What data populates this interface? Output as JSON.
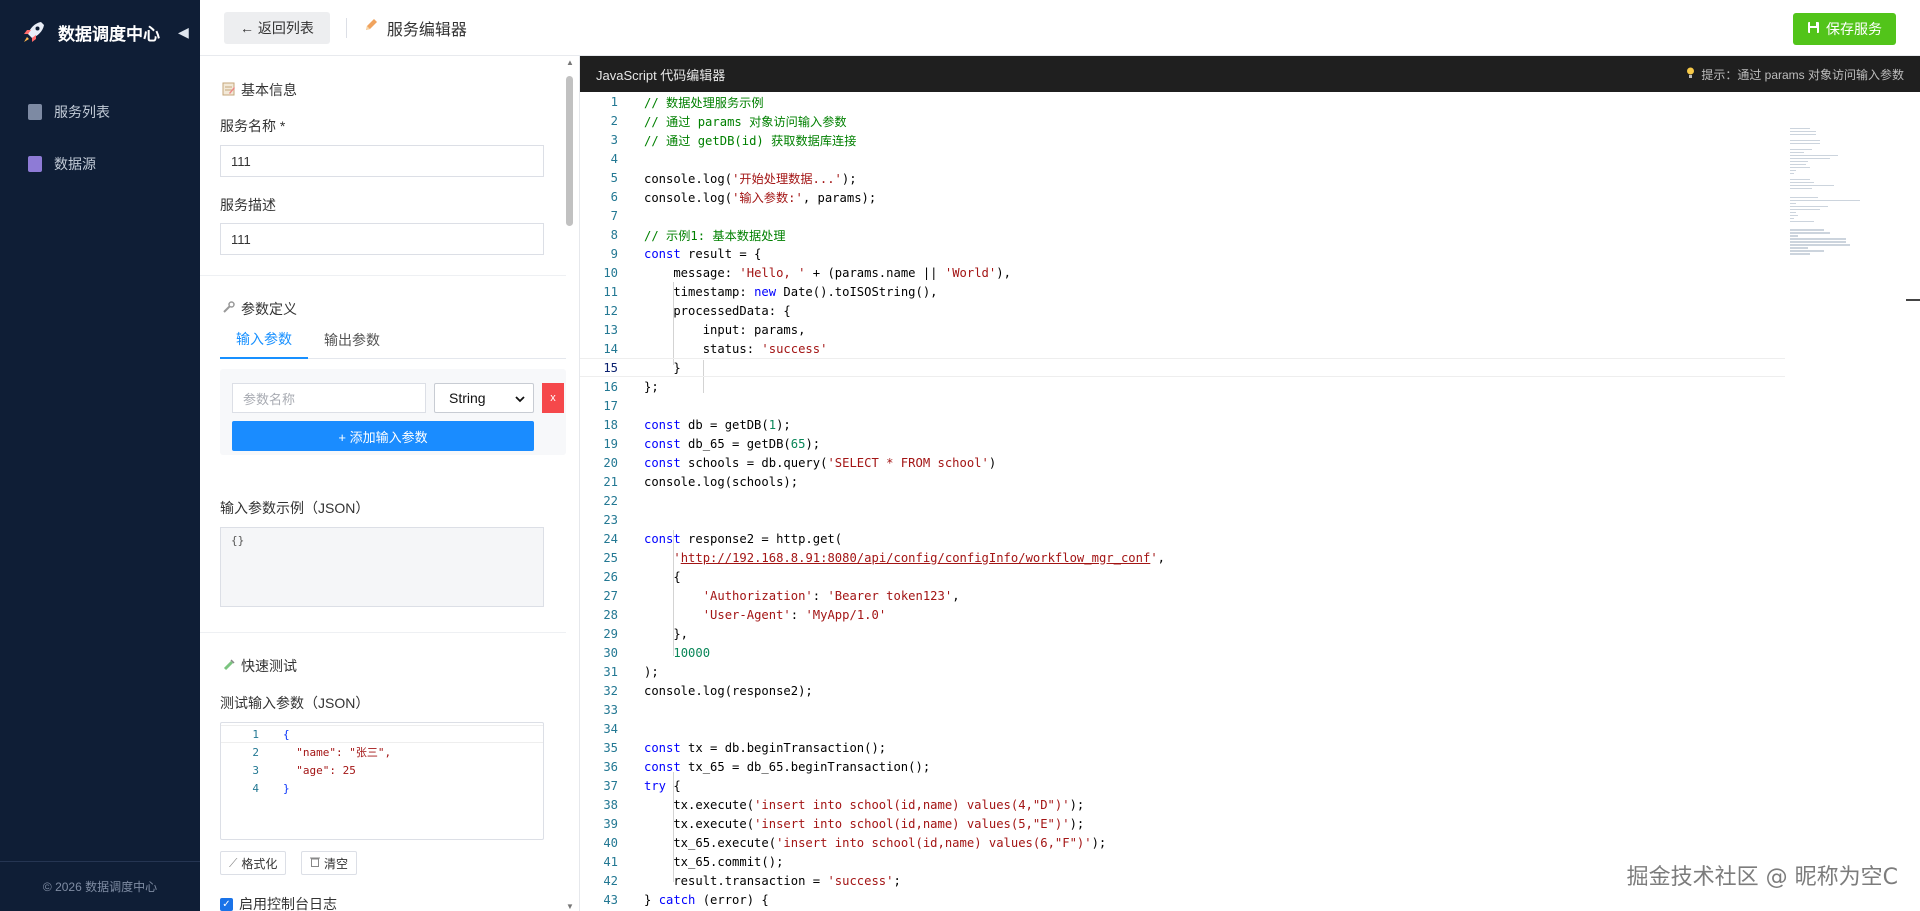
{
  "sidebar": {
    "brand": "数据调度中心",
    "items": [
      {
        "label": "服务列表",
        "icon": "document-icon",
        "color": "#7d8aa3"
      },
      {
        "label": "数据源",
        "icon": "database-icon",
        "color": "#8e7bd6"
      }
    ],
    "footer": "© 2026 数据调度中心"
  },
  "topbar": {
    "back_label": "← 返回列表",
    "title": "服务编辑器",
    "save_label": "保存服务"
  },
  "form": {
    "basic_title": "基本信息",
    "name_label": "服务名称 *",
    "name_value": "111",
    "desc_label": "服务描述",
    "desc_value": "111",
    "params_title": "参数定义",
    "tabs": [
      "输入参数",
      "输出参数"
    ],
    "param_placeholder": "参数名称",
    "param_type": "String",
    "param_delete": "x",
    "add_param": "+ 添加输入参数",
    "input_example_label": "输入参数示例（JSON）",
    "input_example_value": "{}",
    "quick_test_title": "快速测试",
    "test_input_label": "测试输入参数（JSON）",
    "test_lines": [
      {
        "n": "1",
        "code": "{"
      },
      {
        "n": "2",
        "code": "  \"name\": \"张三\","
      },
      {
        "n": "3",
        "code": "  \"age\": 25"
      },
      {
        "n": "4",
        "code": "}"
      }
    ],
    "format_btn": "格式化",
    "clear_btn": "清空",
    "console_log_label": "启用控制台日志"
  },
  "editor": {
    "title": "JavaScript 代码编辑器",
    "hint": "提示：通过 params 对象访问输入参数",
    "current_line": 15
  },
  "watermark": "掘金技术社区 @ 昵称为空C"
}
